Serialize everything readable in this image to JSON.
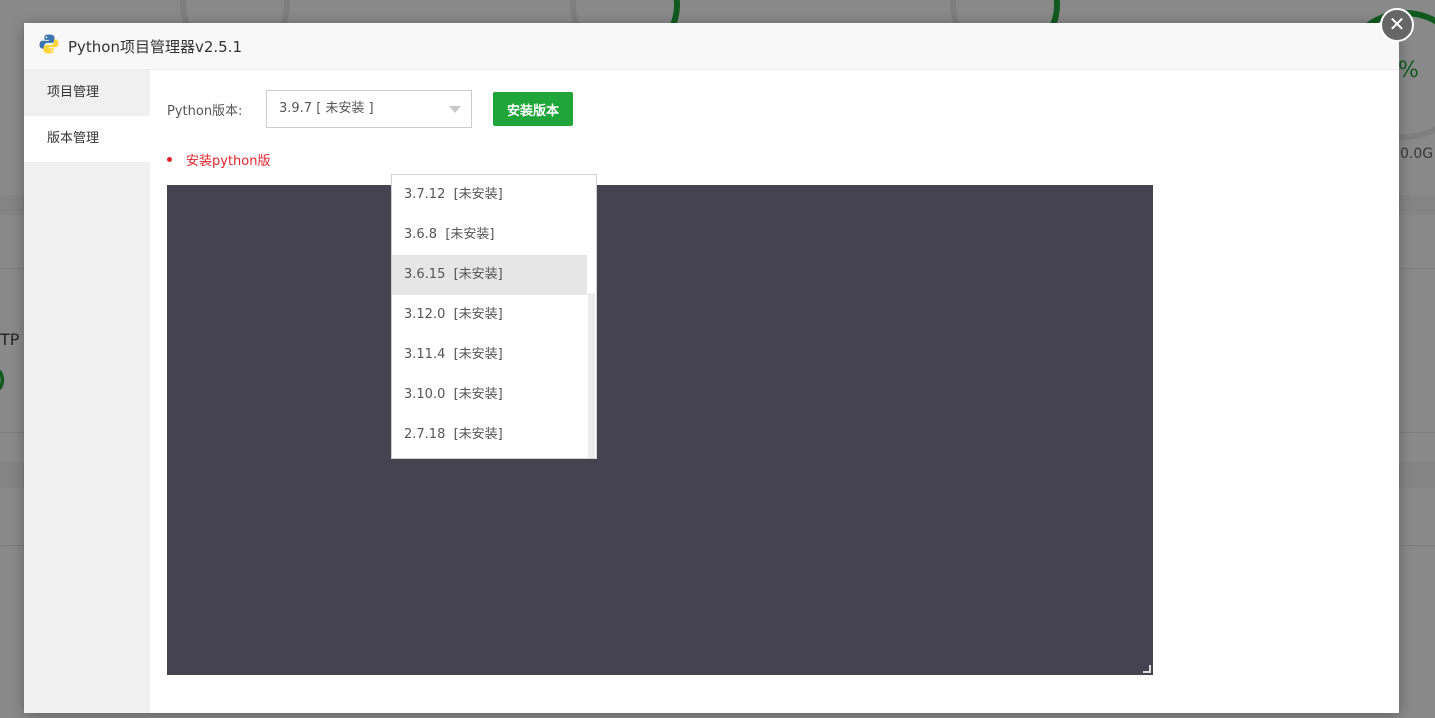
{
  "window": {
    "title": "Python项目管理器v2.5.1",
    "close_glyph": "✕"
  },
  "background": {
    "fragments": [
      "%",
      "0.0G",
      "TP",
      ")"
    ]
  },
  "sidebar": {
    "items": [
      {
        "label": "项目管理"
      },
      {
        "label": "版本管理"
      }
    ]
  },
  "form": {
    "label": "Python版本:",
    "selected": "3.9.7 [ 未安装 ]",
    "install_button": "安装版本",
    "notice": "安装python版"
  },
  "dropdown": {
    "options": [
      "3.7.12  [未安装]",
      "3.6.8  [未安装]",
      "3.6.15  [未安装]",
      "3.12.0  [未安装]",
      "3.11.4  [未安装]",
      "3.10.0  [未安装]",
      "2.7.18  [未安装]"
    ],
    "hovered_index": 2
  },
  "colors": {
    "accent": "#20a53a",
    "console_bg": "#44434f",
    "notice": "#e0252b"
  },
  "icons": {
    "app": "python-logo-icon",
    "close": "close-icon"
  }
}
